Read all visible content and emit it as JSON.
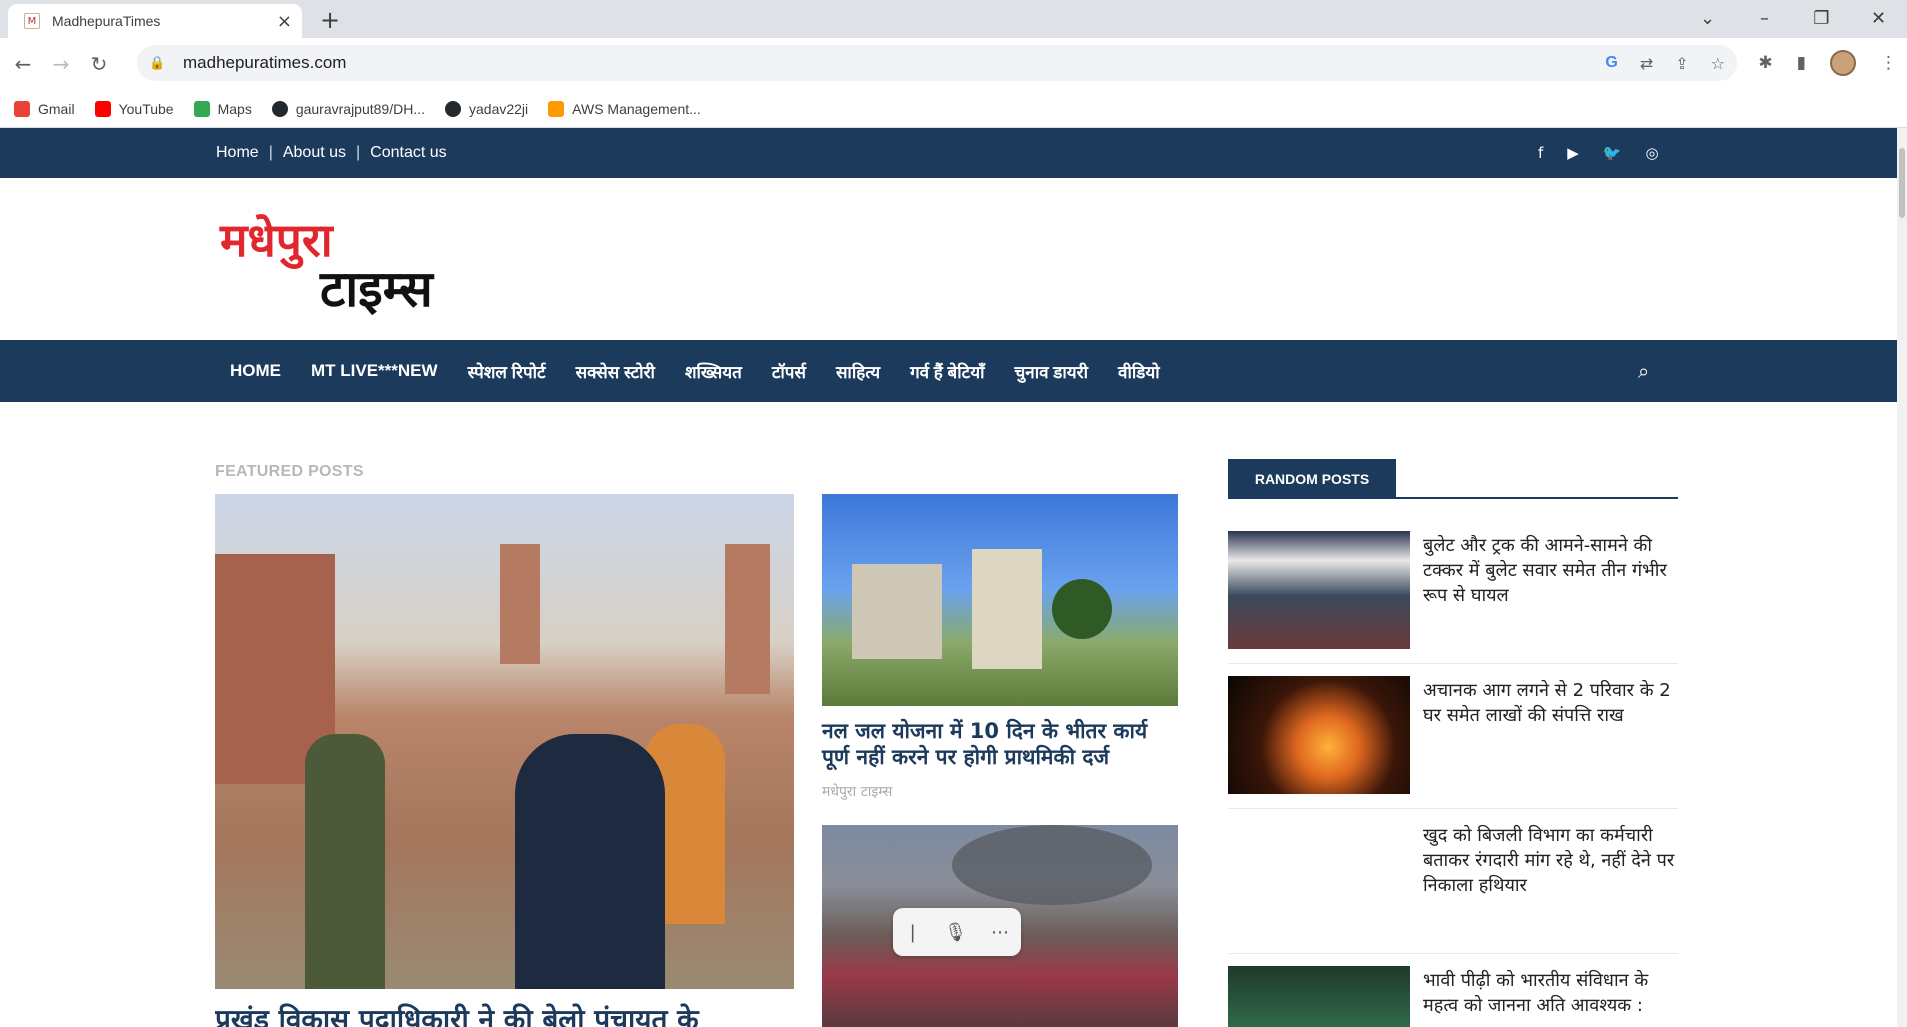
{
  "browser": {
    "tab_title": "MadhepuraTimes",
    "tab_close": "×",
    "new_tab": "+",
    "url": "madhepuratimes.com",
    "bookmarks": [
      {
        "label": "Gmail",
        "color": "#ea4335"
      },
      {
        "label": "YouTube",
        "color": "#ff0000"
      },
      {
        "label": "Maps",
        "color": "#34a853"
      },
      {
        "label": "gauravrajput89/DH...",
        "color": "#24292e"
      },
      {
        "label": "yadav22ji",
        "color": "#24292e"
      },
      {
        "label": "AWS Management...",
        "color": "#ff9900"
      }
    ]
  },
  "site": {
    "top_links": [
      "Home",
      "About us",
      "Contact us"
    ],
    "logo_line1": "मधेपुरा",
    "logo_line2": "टाइम्स",
    "nav": [
      "HOME",
      "MT LIVE***NEW",
      "स्पेशल रिपोर्ट",
      "सक्सेस स्टोरी",
      "शख्सियत",
      "टॉपर्स",
      "साहित्य",
      "गर्व हैं बेटियाँ",
      "चुनाव डायरी",
      "वीडियो"
    ],
    "featured_label": "FEATURED POSTS",
    "big_post_title": "प्रखंड विकास पदाधिकारी ने की बेलो पंचायत के",
    "mid_post_title": "नल जल योजना में 10 दिन के भीतर कार्य पूर्ण नहीं करने पर होगी प्राथमिकी दर्ज",
    "mid_post_author": "मधेपुरा टाइम्स",
    "random_label": "RANDOM POSTS",
    "random_posts": [
      "बुलेट और ट्रक की आमने-सामने की टक्कर में बुलेट सवार समेत तीन गंभीर रूप से घायल",
      "अचानक आग लगने से 2 परिवार के 2 घर समेत लाखों की संपत्ति राख",
      "खुद को बिजली विभाग का कर्मचारी बताकर रंगदारी मांग रहे थे, नहीं देने पर निकाला हथियार",
      "भावी पीढ़ी को भारतीय संविधान के महत्व को जानना अति आवश्यक :"
    ]
  },
  "colors": {
    "brand_navy": "#1c3a5c",
    "logo_red": "#e1262d"
  }
}
